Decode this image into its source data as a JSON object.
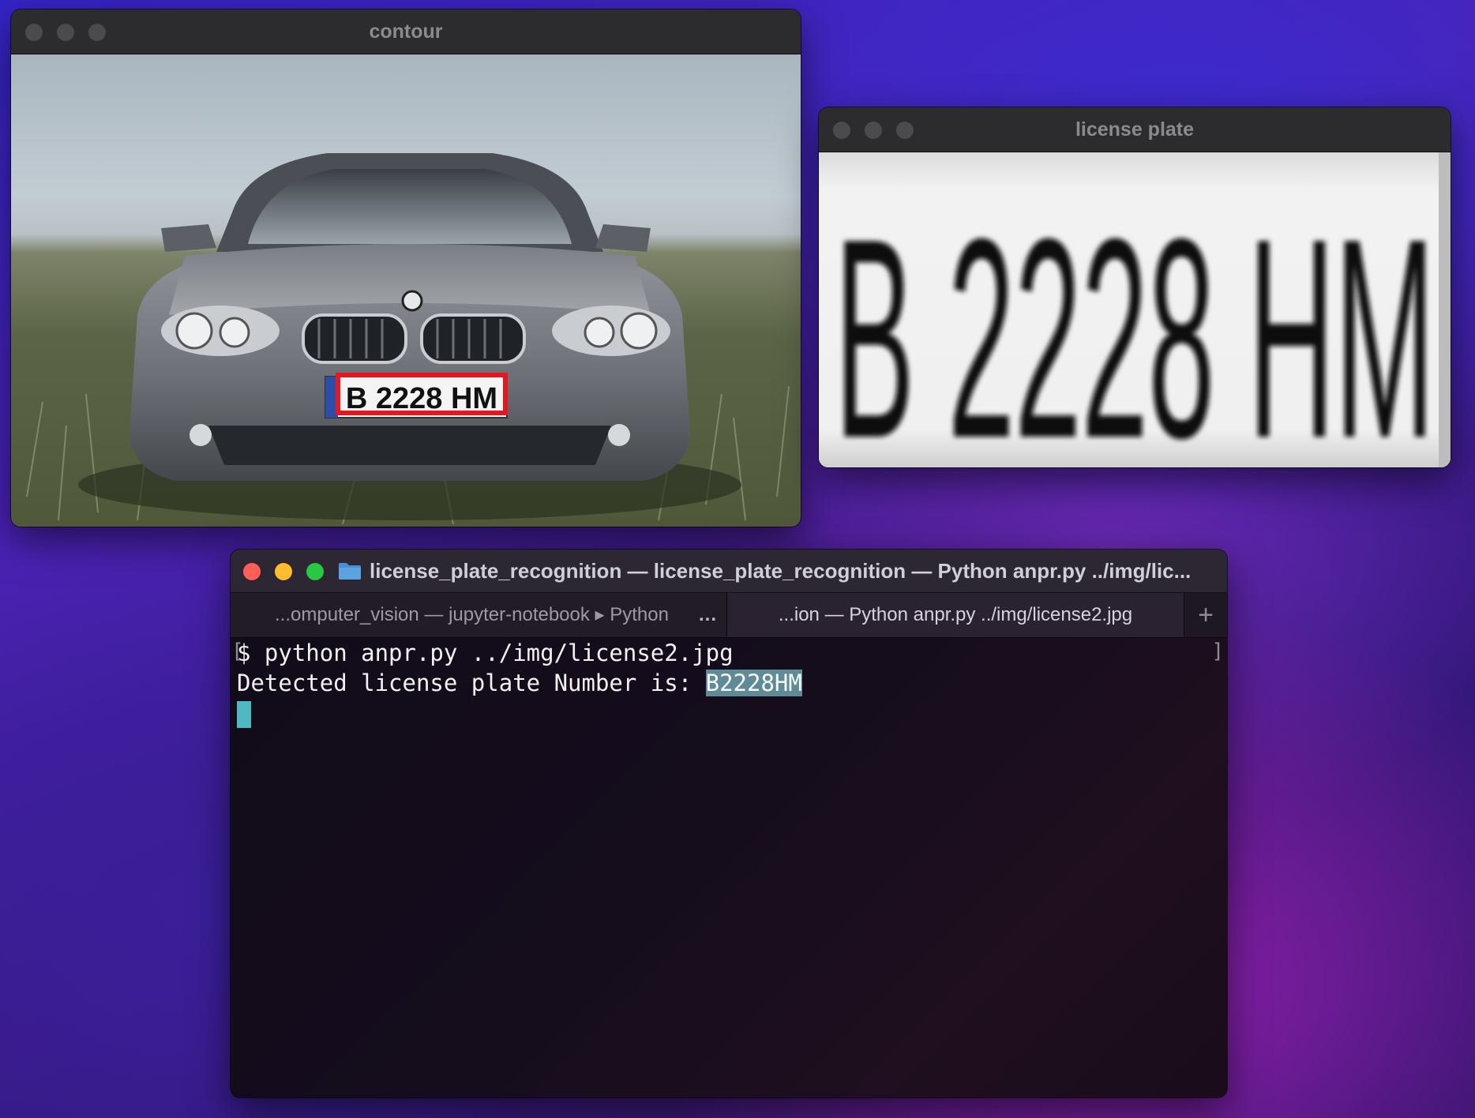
{
  "windows": {
    "contour": {
      "title": "contour",
      "plate_text": "B 2228 HM"
    },
    "license_plate": {
      "title": "license plate",
      "plate_text": "B 2228 HM"
    },
    "terminal": {
      "title": "license_plate_recognition — license_plate_recognition — Python anpr.py ../img/lic...",
      "tabs": [
        {
          "label": "...omputer_vision — jupyter-notebook ▸ Python",
          "active": false
        },
        {
          "label": "...ion — Python anpr.py ../img/license2.jpg",
          "active": true
        }
      ],
      "tab_more": "...",
      "tab_add": "+",
      "lines": {
        "command": "$ python anpr.py ../img/license2.jpg",
        "output_prefix": "Detected license plate Number is: ",
        "output_value": "B2228HM"
      }
    }
  },
  "colors": {
    "detection_box": "#e8161f",
    "selection_highlight": "#5f8a96",
    "cursor": "#4fb8c0",
    "traffic_close": "#ff5f57",
    "traffic_minimize": "#febc2e",
    "traffic_zoom": "#28c840"
  }
}
